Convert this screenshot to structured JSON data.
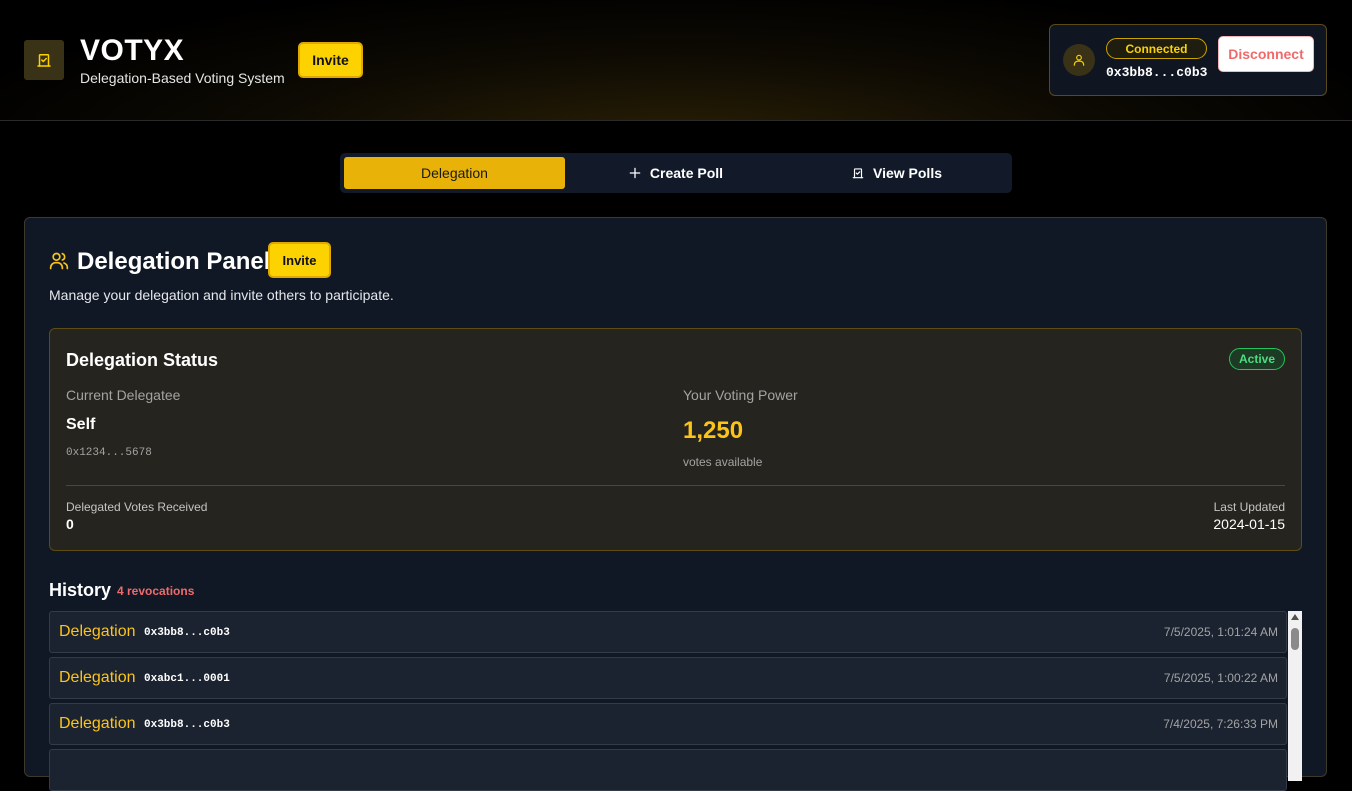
{
  "header": {
    "app_title": "VOTYX",
    "app_subtitle": "Delegation-Based Voting System",
    "invite_label": "Invite",
    "logo_icon": "ballot-box-icon",
    "wallet": {
      "avatar_icon": "user-icon",
      "status": "Connected",
      "address": "0x3bb8...c0b3",
      "disconnect_label": "Disconnect"
    }
  },
  "tabs": [
    {
      "label": "Delegation",
      "icon": "",
      "active": true
    },
    {
      "label": "Create Poll",
      "icon": "plus-icon",
      "active": false
    },
    {
      "label": "View Polls",
      "icon": "ballot-box-icon",
      "active": false
    }
  ],
  "panel": {
    "icon": "users-icon",
    "title": "Delegation Panel",
    "invite_label": "Invite",
    "description": "Manage your delegation and invite others to participate.",
    "status_card": {
      "title": "Delegation Status",
      "badge": "Active",
      "current_delegatee_label": "Current Delegatee",
      "current_delegatee_name": "Self",
      "current_delegatee_address": "0x1234...5678",
      "voting_power_label": "Your Voting Power",
      "voting_power_value": "1,250",
      "voting_power_sub": "votes available",
      "received_label": "Delegated Votes Received",
      "received_value": "0",
      "updated_label": "Last Updated",
      "updated_value": "2024-01-15"
    },
    "history": {
      "title": "History",
      "count_label": "4 revocations",
      "rows": [
        {
          "type": "Delegation",
          "address": "0x3bb8...c0b3",
          "time": "7/5/2025, 1:01:24 AM"
        },
        {
          "type": "Delegation",
          "address": "0xabc1...0001",
          "time": "7/5/2025, 1:00:22 AM"
        },
        {
          "type": "Delegation",
          "address": "0x3bb8...c0b3",
          "time": "7/4/2025, 7:26:33 PM"
        }
      ]
    }
  },
  "colors": {
    "accent": "#fcd200",
    "active_tab": "#e9b208",
    "panel_bg": "#101826",
    "danger": "#f06a6a",
    "success": "#4ade80"
  }
}
